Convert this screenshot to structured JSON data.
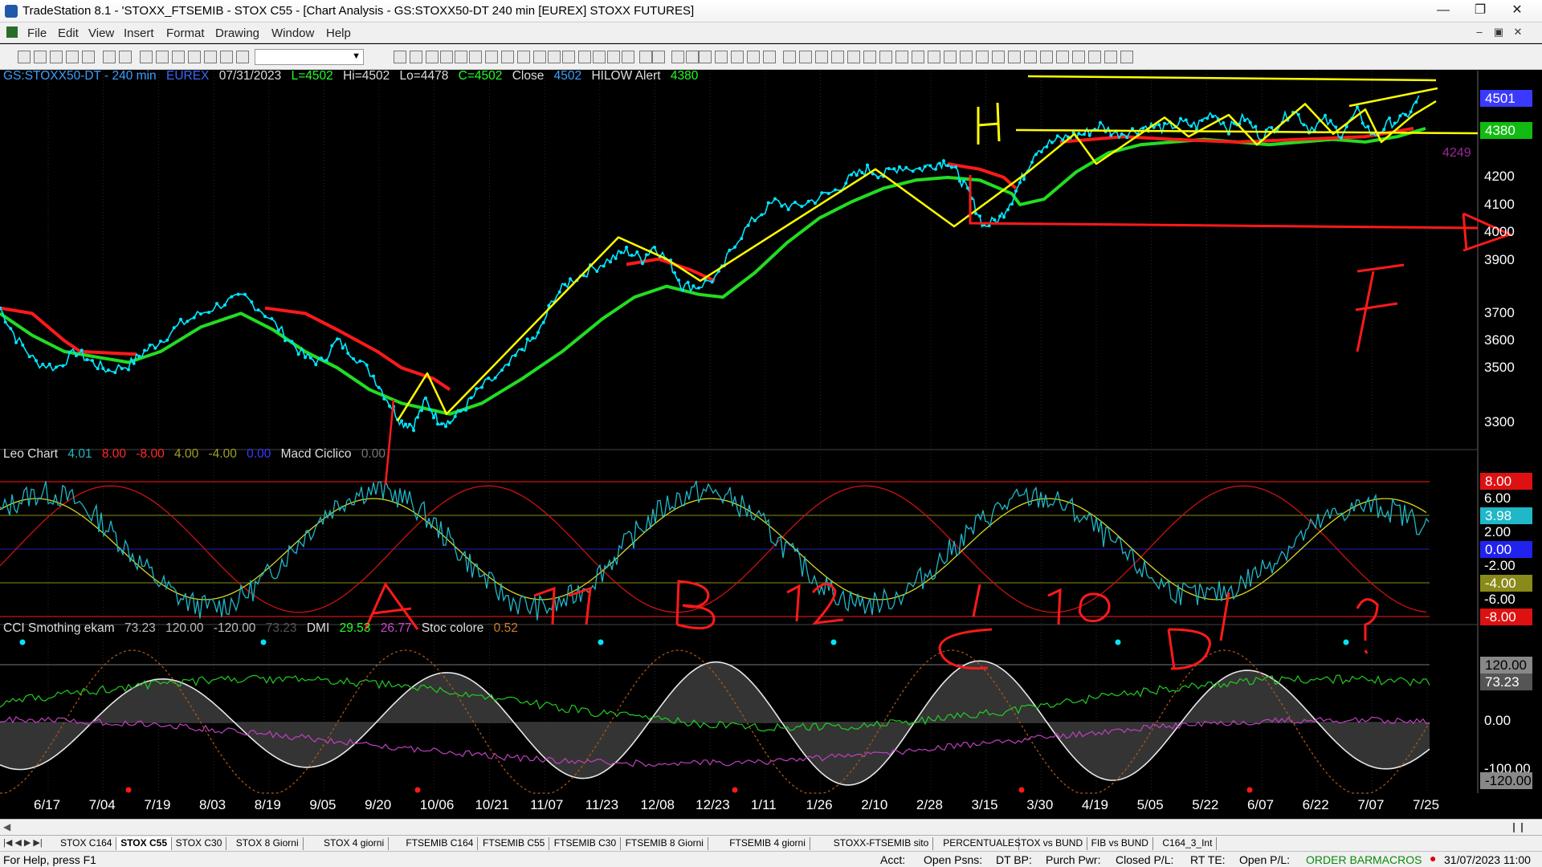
{
  "window": {
    "title": "TradeStation 8.1 - 'STOXX_FTSEMIB - STOX C55 - [Chart Analysis - GS:STOXX50-DT  240 min  [EUREX] STOXX FUTURES]"
  },
  "menu": [
    "File",
    "Edit",
    "View",
    "Insert",
    "Format",
    "Drawing",
    "Window",
    "Help"
  ],
  "chart_header": {
    "symbol": "GS:STOXX50-DT - 240 min",
    "exchange": "EUREX",
    "date": "07/31/2023",
    "last": "L=4502",
    "hi": "Hi=4502",
    "lo": "Lo=4478",
    "close": "C=4502",
    "close_label": "Close",
    "close_value": "4502",
    "alert_label": "HILOW Alert",
    "alert_value": "4380"
  },
  "leo_header": {
    "name": "Leo Chart",
    "values": [
      "4.01",
      "8.00",
      "-8.00",
      "4.00",
      "-4.00",
      "0.00"
    ],
    "macd": "Macd Ciclico",
    "macd_value": "0.00"
  },
  "cci_header": {
    "name": "CCI Smothing ekam",
    "values": [
      "73.23",
      "120.00",
      "-120.00",
      "73.23"
    ],
    "dmi": "DMI",
    "dmi_values": [
      "29.53",
      "26.77"
    ],
    "stoc": "Stoc colore",
    "stoc_value": "0.52"
  },
  "price_axis": [
    "4200",
    "4100",
    "4000",
    "3900",
    "3700",
    "3600",
    "3500",
    "3300"
  ],
  "price_boxes": {
    "last": "4501",
    "alert": "4380",
    "level": "4249"
  },
  "leo_axis": [
    "6.00",
    "2.00",
    "-2.00",
    "-6.00"
  ],
  "leo_boxes": {
    "top": "8.00",
    "value": "3.98",
    "zero": "0.00",
    "neg4": "-4.00",
    "bottom": "-8.00"
  },
  "cci_axis": [
    "0.00",
    "-100.00"
  ],
  "cci_boxes": {
    "top": "120.00",
    "value": "73.23",
    "bottom": "-120.00"
  },
  "dates": [
    "6/17",
    "7/04",
    "7/19",
    "8/03",
    "8/19",
    "9/05",
    "9/20",
    "10/06",
    "10/21",
    "11/07",
    "11/23",
    "12/08",
    "12/23",
    "1/11",
    "1/26",
    "2/10",
    "2/28",
    "3/15",
    "3/30",
    "4/19",
    "5/05",
    "5/22",
    "6/07",
    "6/22",
    "7/07",
    "7/25"
  ],
  "annotations": {
    "h": "H",
    "f": "F",
    "a": "A",
    "b": "B",
    "c": "C",
    "d": "D",
    "q": "?",
    "c11": "11",
    "c12": "12",
    "c10": "10"
  },
  "tabs": [
    "STOX C164",
    "STOX C55",
    "STOX  C30",
    "STOX  8 Giorni",
    "STOX 4 giorni",
    "FTSEMIB C164",
    "FTSEMIB C55",
    "FTSEMIB C30",
    "FTSEMIB  8 Giorni",
    "FTSEMIB  4 giorni",
    "STOXX-FTSEMIB sito",
    "PERCENTUALE",
    "STOX vs BUND",
    "FIB vs BUND",
    "C164_3_Int"
  ],
  "status": {
    "help": "For Help, press F1",
    "acct": "Acct:",
    "open_psns": "Open Psns:",
    "dt_bp": "DT BP:",
    "purch_pwr": "Purch Pwr:",
    "closed_pl": "Closed P/L:",
    "rt_te": "RT TE:",
    "open_pl": "Open P/L:",
    "order_bar": "ORDER BAR",
    "macros": "MACROS",
    "datetime": "31/07/2023 11:00"
  },
  "colors": {
    "cyan": "#00e5ff",
    "red": "#ff1a1a",
    "green": "#22dd22",
    "yellow": "#ffff00",
    "magenta": "#c040c0",
    "blue_box": "#3a3aff"
  }
}
